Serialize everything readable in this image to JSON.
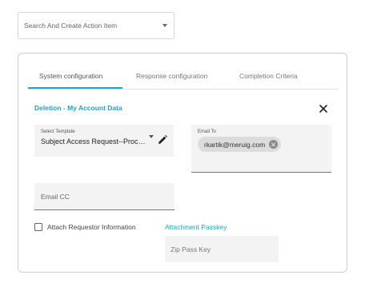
{
  "search": {
    "placeholder": "Search And Create Action Item",
    "icon": "chevron-down-icon"
  },
  "tabs": [
    {
      "label": "System configuration",
      "active": true
    },
    {
      "label": "Response configuration",
      "active": false
    },
    {
      "label": "Completion Criteria",
      "active": false
    }
  ],
  "section": {
    "title": "Deletion - My Account Data"
  },
  "template": {
    "label": "Select Template",
    "value": "Subject Access Request--Processing"
  },
  "email_to": {
    "label": "Email To",
    "chips": [
      "rkartik@meruig.com"
    ]
  },
  "email_cc": {
    "placeholder": "Email CC"
  },
  "attach": {
    "label": "Attach Requestor Information",
    "checked": false
  },
  "passkey": {
    "title": "Attachment Passkey",
    "placeholder": "Zip Pass Key"
  },
  "colors": {
    "accent": "#1aa7c4",
    "field_bg": "#f3f3f3"
  }
}
